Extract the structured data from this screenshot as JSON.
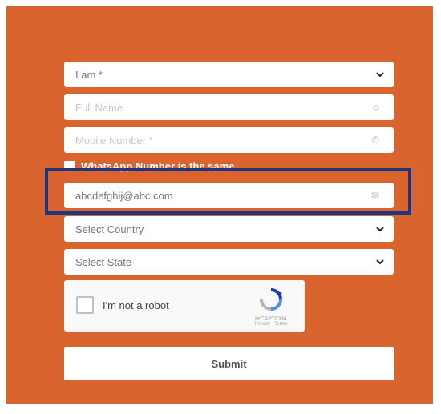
{
  "form": {
    "role_select": {
      "value": "I am *"
    },
    "full_name": {
      "placeholder": "Full Name"
    },
    "mobile": {
      "placeholder": "Mobile Number *"
    },
    "whatsapp_same": {
      "label": "WhatsApp Number is the same",
      "checked": false
    },
    "email": {
      "value": "abcdefghij@abc.com"
    },
    "country_select": {
      "value": "Select Country"
    },
    "state_select": {
      "value": "Select State"
    },
    "captcha": {
      "label": "I'm not a robot",
      "brand": "reCAPTCHA",
      "terms": "Privacy - Terms"
    },
    "submit_label": "Submit"
  },
  "colors": {
    "panel_bg": "#d9642d",
    "highlight_border": "#1f3580",
    "field_bg": "#ffffff"
  }
}
